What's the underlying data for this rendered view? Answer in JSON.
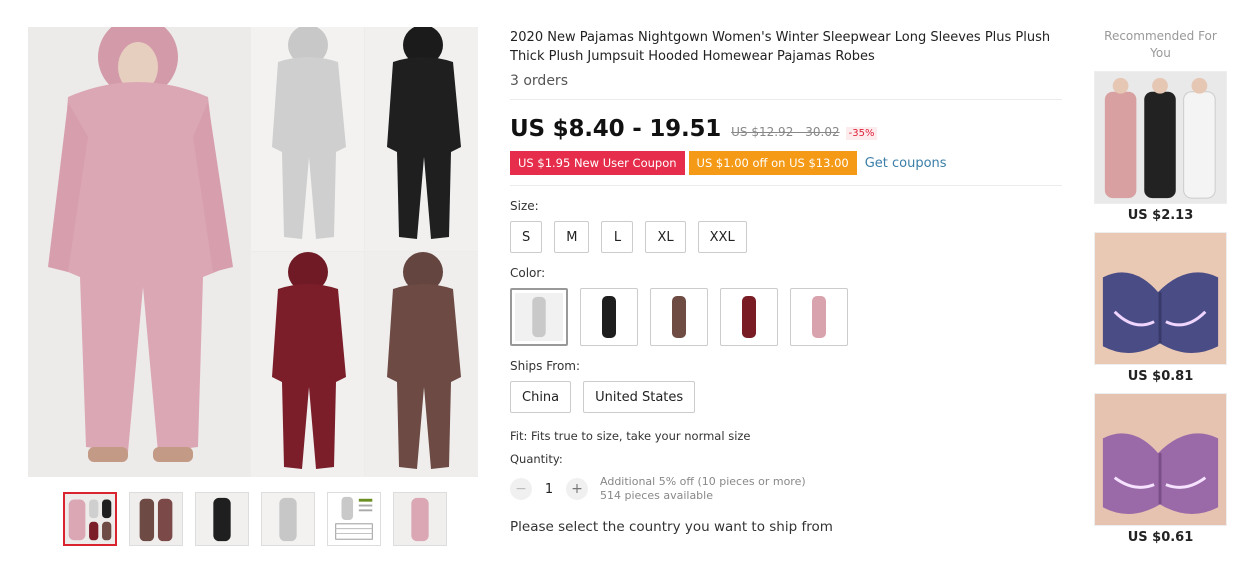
{
  "product": {
    "title": "2020 New Pajamas Nightgown Women's Winter Sleepwear Long Sleeves Plus Plush Thick Plush Jumpsuit Hooded Homewear Pajamas Robes",
    "orders": "3 orders"
  },
  "price": {
    "current": "US $8.40 - 19.51",
    "original": "US $12.92 - 30.02",
    "discount": "-35%"
  },
  "coupons": {
    "new_user": "US $1.95 New User Coupon",
    "store": "US $1.00 off on US $13.00",
    "get_coupons": "Get coupons"
  },
  "size": {
    "label": "Size:",
    "options": [
      "S",
      "M",
      "L",
      "XL",
      "XXL"
    ]
  },
  "color": {
    "label": "Color:",
    "swatches": [
      {
        "icon": "grey-jumpsuit-icon",
        "color": "#c9c9c9"
      },
      {
        "icon": "black-jumpsuit-icon",
        "color": "#1e1e1e"
      },
      {
        "icon": "brown-jumpsuit-icon",
        "color": "#6e4c44"
      },
      {
        "icon": "wine-jumpsuit-icon",
        "color": "#7a1c24"
      },
      {
        "icon": "pink-jumpsuit-icon",
        "color": "#d9a3ad"
      }
    ]
  },
  "ships_from": {
    "label": "Ships From:",
    "options": [
      "China",
      "United States"
    ]
  },
  "fit": "Fit: Fits true to size, take your normal size",
  "quantity": {
    "label": "Quantity:",
    "value": "1",
    "minus": "−",
    "plus": "+",
    "note1": "Additional 5% off (10 pieces or more)",
    "note2": "514 pieces available"
  },
  "ship_select": "Please select the country you want to ship from",
  "recommended": {
    "title": "Recommended For You",
    "items": [
      {
        "price": "US $2.13",
        "icon": "tracksuit-photo-icon"
      },
      {
        "price": "US $0.81",
        "icon": "blue-bra-photo-icon"
      },
      {
        "price": "US $0.61",
        "icon": "purple-bra-photo-icon"
      }
    ]
  },
  "gallery": {
    "main_colors": [
      "#dca7b5",
      "#cfcfcf",
      "#1f1f1f",
      "#7b1e2a",
      "#6d4a44"
    ],
    "thumb_icons": [
      "collage-thumb-icon",
      "brown-thumb-icon",
      "black-thumb-icon",
      "grey-thumb-icon",
      "size-chart-thumb-icon",
      "pink-thumb-icon"
    ]
  }
}
